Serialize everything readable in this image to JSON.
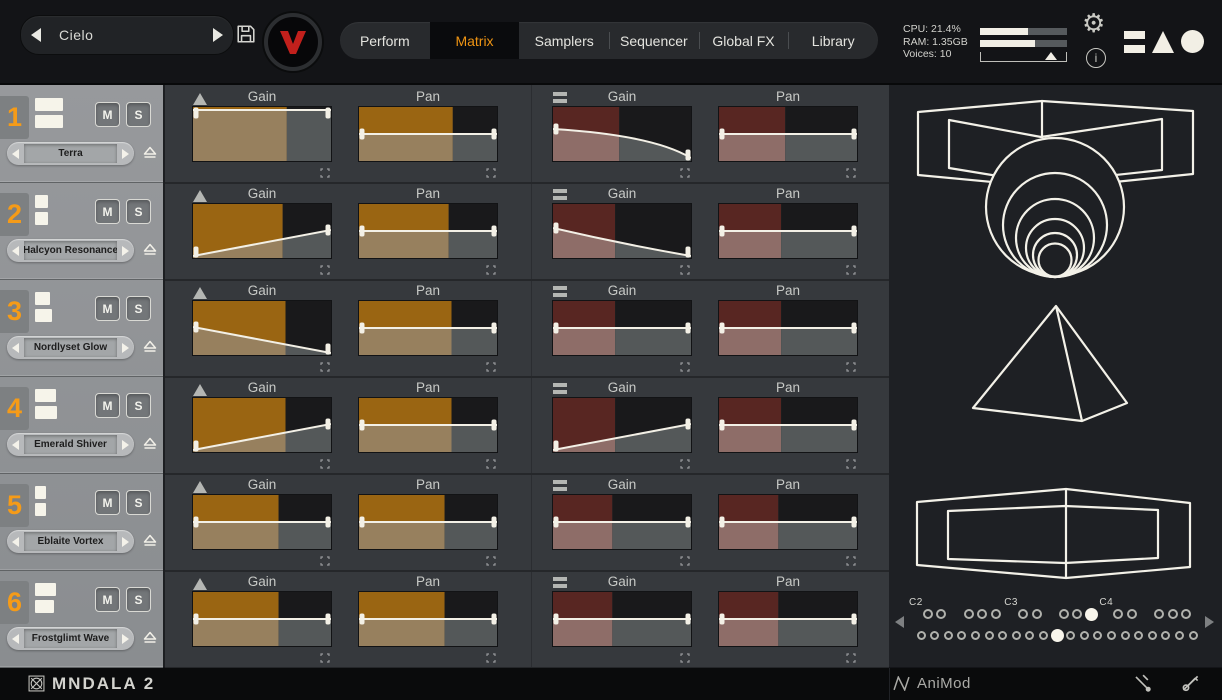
{
  "colors": {
    "accent_orange": "#ee9413",
    "logo_red": "#c2201c",
    "amber_above": "#9a6512",
    "amber_below": "#97805e",
    "red_above": "#582622",
    "red_below": "#8e6d68",
    "dark_above": "#19191b",
    "dark_below": "#545859",
    "env_line": "#f3f0e6"
  },
  "top_bar": {
    "preset_name": "Cielo",
    "tabs": [
      {
        "label": "Perform",
        "active": false
      },
      {
        "label": "Matrix",
        "active": true
      },
      {
        "label": "Samplers",
        "active": false
      },
      {
        "label": "Sequencer",
        "active": false
      },
      {
        "label": "Global FX",
        "active": false
      },
      {
        "label": "Library",
        "active": false
      }
    ],
    "stats": {
      "cpu": "CPU: 21.4%",
      "ram": "RAM: 1.35GB",
      "voices": "Voices: 10"
    },
    "meters": {
      "cpu_fill": 0.55,
      "ram_fill": 0.63,
      "slider_pos": 0.82
    }
  },
  "sidebar": {
    "slots": [
      {
        "number": "1",
        "name": "Terra",
        "mute_label": "M",
        "solo_label": "S",
        "layer_bars": [
          28,
          28
        ]
      },
      {
        "number": "2",
        "name": "Halcyon Resonance",
        "mute_label": "M",
        "solo_label": "S",
        "layer_bars": [
          13,
          13
        ]
      },
      {
        "number": "3",
        "name": "Nordlyset Glow",
        "mute_label": "M",
        "solo_label": "S",
        "layer_bars": [
          15,
          17
        ]
      },
      {
        "number": "4",
        "name": "Emerald Shiver",
        "mute_label": "M",
        "solo_label": "S",
        "layer_bars": [
          21,
          22
        ]
      },
      {
        "number": "5",
        "name": "Eblaite Vortex",
        "mute_label": "M",
        "solo_label": "S",
        "layer_bars": [
          11,
          11
        ]
      },
      {
        "number": "6",
        "name": "Frostglimt Wave",
        "mute_label": "M",
        "solo_label": "S",
        "layer_bars": [
          21,
          19
        ]
      }
    ]
  },
  "matrix": {
    "group_icons": [
      "triangle-icon",
      "bars-icon"
    ],
    "rows": [
      {
        "cells": [
          {
            "param": "Gain",
            "palette": "amber",
            "curve": "flat-top",
            "active_ratio": 0.68
          },
          {
            "param": "Pan",
            "palette": "amber",
            "curve": "flat-mid",
            "active_ratio": 0.68
          },
          {
            "param": "Gain",
            "palette": "red",
            "curve": "fall-curved-late",
            "active_ratio": 0.48
          },
          {
            "param": "Pan",
            "palette": "red",
            "curve": "flat-mid",
            "active_ratio": 0.48
          }
        ]
      },
      {
        "cells": [
          {
            "param": "Gain",
            "palette": "amber",
            "curve": "rise-linear",
            "active_ratio": 0.65
          },
          {
            "param": "Pan",
            "palette": "amber",
            "curve": "flat-mid",
            "active_ratio": 0.65
          },
          {
            "param": "Gain",
            "palette": "red",
            "curve": "fall-curved-early",
            "active_ratio": 0.45
          },
          {
            "param": "Pan",
            "palette": "red",
            "curve": "flat-mid",
            "active_ratio": 0.45
          }
        ]
      },
      {
        "cells": [
          {
            "param": "Gain",
            "palette": "amber",
            "curve": "fall-linear",
            "active_ratio": 0.67
          },
          {
            "param": "Pan",
            "palette": "amber",
            "curve": "flat-mid",
            "active_ratio": 0.67
          },
          {
            "param": "Gain",
            "palette": "red",
            "curve": "flat-mid",
            "active_ratio": 0.45
          },
          {
            "param": "Pan",
            "palette": "red",
            "curve": "flat-mid",
            "active_ratio": 0.45
          }
        ]
      },
      {
        "cells": [
          {
            "param": "Gain",
            "palette": "amber",
            "curve": "rise-linear",
            "active_ratio": 0.67
          },
          {
            "param": "Pan",
            "palette": "amber",
            "curve": "flat-mid",
            "active_ratio": 0.67
          },
          {
            "param": "Gain",
            "palette": "red",
            "curve": "rise-linear",
            "active_ratio": 0.45
          },
          {
            "param": "Pan",
            "palette": "red",
            "curve": "flat-mid",
            "active_ratio": 0.45
          }
        ]
      },
      {
        "cells": [
          {
            "param": "Gain",
            "palette": "amber",
            "curve": "flat-mid",
            "active_ratio": 0.62
          },
          {
            "param": "Pan",
            "palette": "amber",
            "curve": "flat-mid",
            "active_ratio": 0.62
          },
          {
            "param": "Gain",
            "palette": "red",
            "curve": "flat-mid",
            "active_ratio": 0.43
          },
          {
            "param": "Pan",
            "palette": "red",
            "curve": "flat-mid",
            "active_ratio": 0.43
          }
        ]
      },
      {
        "cells": [
          {
            "param": "Gain",
            "palette": "amber",
            "curve": "flat-mid",
            "active_ratio": 0.62
          },
          {
            "param": "Pan",
            "palette": "amber",
            "curve": "flat-mid",
            "active_ratio": 0.62
          },
          {
            "param": "Gain",
            "palette": "red",
            "curve": "flat-mid",
            "active_ratio": 0.43
          },
          {
            "param": "Pan",
            "palette": "red",
            "curve": "flat-mid",
            "active_ratio": 0.43
          }
        ]
      }
    ]
  },
  "right_panel": {
    "shapes": [
      "wireframe-ring-slab",
      "wireframe-pyramid",
      "wireframe-frame-slab"
    ],
    "keyboard": {
      "labels": [
        {
          "text": "C2",
          "white_index": 0
        },
        {
          "text": "C3",
          "white_index": 7
        },
        {
          "text": "C4",
          "white_index": 14
        }
      ],
      "white_count": 21,
      "octaves": 3,
      "active_black_index": 9,
      "active_white_index": 10
    }
  },
  "bottom_bar": {
    "app_name": "MNDALA 2",
    "module_name": "AniMod",
    "icons": [
      "n-wave-icon",
      "tuning-fork-icon",
      "pitch-slash-icon"
    ]
  }
}
